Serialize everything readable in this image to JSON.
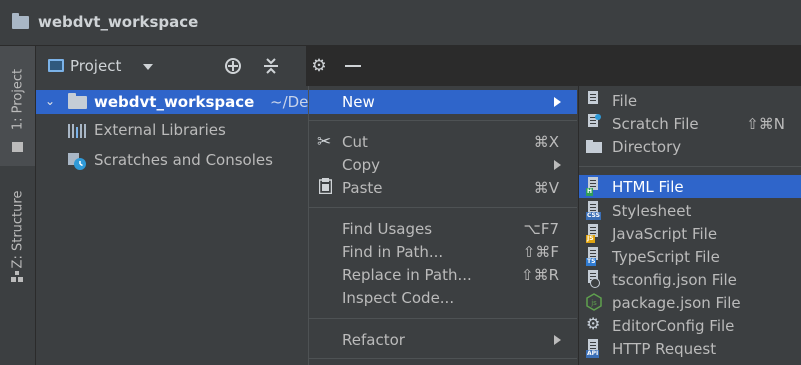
{
  "window": {
    "title": "webdvt_workspace"
  },
  "side_tabs": [
    {
      "label": "1: Project"
    },
    {
      "label": "Z: Structure"
    }
  ],
  "toolbar": {
    "view_label": "Project"
  },
  "tree": [
    {
      "label": "webdvt_workspace",
      "path": "~/De"
    },
    {
      "label": "External Libraries"
    },
    {
      "label": "Scratches and Consoles"
    }
  ],
  "context_menu": [
    {
      "label": "New",
      "shortcut": "",
      "submenu": true
    },
    {
      "label": "Cut",
      "shortcut": "⌘X"
    },
    {
      "label": "Copy",
      "shortcut": "",
      "submenu": true
    },
    {
      "label": "Paste",
      "shortcut": "⌘V"
    },
    {
      "label": "Find Usages",
      "shortcut": "⌥F7"
    },
    {
      "label": "Find in Path...",
      "shortcut": "⇧⌘F"
    },
    {
      "label": "Replace in Path...",
      "shortcut": "⇧⌘R"
    },
    {
      "label": "Inspect Code..."
    },
    {
      "label": "Refactor",
      "submenu": true
    }
  ],
  "new_submenu": [
    {
      "label": "File",
      "icon": "file-icon"
    },
    {
      "label": "Scratch File",
      "shortcut": "⇧⌘N",
      "icon": "scratch-file-icon"
    },
    {
      "label": "Directory",
      "icon": "directory-icon"
    },
    {
      "label": "HTML File",
      "icon": "html-file-icon",
      "badge": "H",
      "badge_color": "#2f9e5a"
    },
    {
      "label": "Stylesheet",
      "icon": "css-file-icon",
      "badge": "CSS",
      "badge_color": "#3b6fb6"
    },
    {
      "label": "JavaScript File",
      "icon": "js-file-icon",
      "badge": "JS",
      "badge_color": "#e0a410"
    },
    {
      "label": "TypeScript File",
      "icon": "ts-file-icon",
      "badge": "TS",
      "badge_color": "#2f7bd2"
    },
    {
      "label": "tsconfig.json File",
      "icon": "tsconfig-file-icon"
    },
    {
      "label": "package.json File",
      "icon": "package-json-icon"
    },
    {
      "label": "EditorConfig File",
      "icon": "gear-icon"
    },
    {
      "label": "HTTP Request",
      "icon": "http-request-icon",
      "badge": "API",
      "badge_color": "#3b6fb6"
    }
  ],
  "colors": {
    "selection": "#2f65ca",
    "panel": "#3c3f41",
    "editor": "#2b2b2b"
  }
}
